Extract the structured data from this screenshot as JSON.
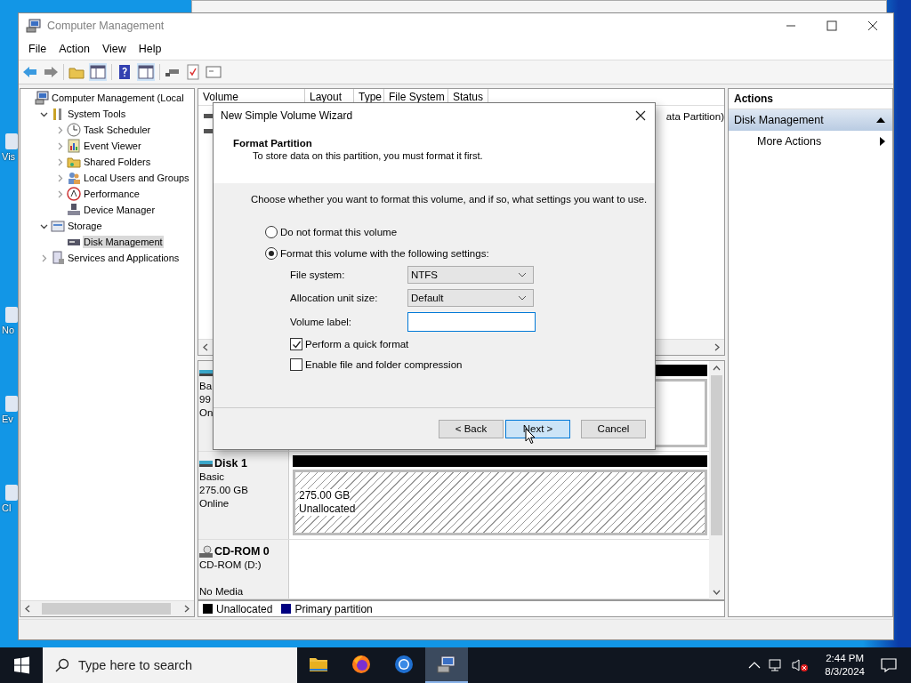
{
  "desktop_icons": [
    {
      "label": "Vis"
    },
    {
      "label": "No"
    },
    {
      "label": "Ev"
    },
    {
      "label": "Cl"
    }
  ],
  "window": {
    "title": "Computer Management"
  },
  "menu": [
    "File",
    "Action",
    "View",
    "Help"
  ],
  "tree": [
    {
      "label": "Computer Management (Local",
      "selected": false,
      "children": [
        {
          "label": "System Tools",
          "expanded": true,
          "selected": false,
          "children": [
            {
              "label": "Task Scheduler",
              "expanded": false,
              "selected": false
            },
            {
              "label": "Event Viewer",
              "expanded": false,
              "selected": false
            },
            {
              "label": "Shared Folders",
              "expanded": false,
              "selected": false
            },
            {
              "label": "Local Users and Groups",
              "expanded": false,
              "selected": false
            },
            {
              "label": "Performance",
              "expanded": false,
              "selected": false
            },
            {
              "label": "Device Manager",
              "selected": false
            }
          ]
        },
        {
          "label": "Storage",
          "expanded": true,
          "selected": false,
          "children": [
            {
              "label": "Disk Management",
              "selected": true
            }
          ]
        },
        {
          "label": "Services and Applications",
          "expanded": false,
          "selected": false
        }
      ]
    }
  ],
  "volume_list": {
    "columns": [
      "Volume",
      "Layout",
      "Type",
      "File System",
      "Status"
    ],
    "rows": [
      {
        "kind": "volume",
        "status": "ata Partition)"
      },
      {
        "kind": "volume"
      }
    ]
  },
  "disks": [
    {
      "kind": "disk",
      "lines": [
        "Ba",
        "99",
        "On"
      ]
    },
    {
      "kind": "disk",
      "name": "Disk 1",
      "lines": [
        "Basic",
        "275.00 GB",
        "Online"
      ],
      "partitions": [
        {
          "kind": "unallocated",
          "size": "275.00 GB",
          "status": "Unallocated"
        }
      ]
    },
    {
      "kind": "cdrom",
      "name": "CD-ROM 0",
      "lines": [
        "CD-ROM (D:)"
      ],
      "media": "No Media"
    }
  ],
  "legend": [
    {
      "label": "Unallocated",
      "color": "#000000"
    },
    {
      "label": "Primary partition",
      "color": "#000080"
    }
  ],
  "actions": {
    "title": "Actions",
    "items": [
      {
        "label": "Disk Management",
        "kind": "section",
        "selected": true
      },
      {
        "label": "More Actions",
        "kind": "submenu",
        "selected": false
      }
    ]
  },
  "dialog": {
    "title": "New Simple Volume Wizard",
    "heading": "Format Partition",
    "subtitle": "To store data on this partition, you must format it first.",
    "instruction": "Choose whether you want to format this volume, and if so, what settings you want to use.",
    "options": [
      {
        "label": "Do not format this volume",
        "selected": false
      },
      {
        "label": "Format this volume with the following settings:",
        "selected": true
      }
    ],
    "fields": [
      {
        "kind": "select",
        "label": "File system:",
        "value": "NTFS"
      },
      {
        "kind": "select",
        "label": "Allocation unit size:",
        "value": "Default"
      },
      {
        "kind": "text",
        "label": "Volume label:",
        "focused": true
      }
    ],
    "checks": [
      {
        "label": "Perform a quick format",
        "checked": true
      },
      {
        "label": "Enable file and folder compression",
        "checked": false
      }
    ],
    "buttons": [
      {
        "label": "< Back",
        "focused": false
      },
      {
        "label": "Next >",
        "focused": true
      },
      {
        "label": "Cancel",
        "focused": false
      }
    ]
  },
  "taskbar": {
    "search_placeholder": "Type here to search",
    "apps": [
      {
        "kind": "folder",
        "selected": false
      },
      {
        "kind": "fox",
        "selected": false
      },
      {
        "kind": "circle",
        "selected": false
      },
      {
        "kind": "management",
        "selected": true
      }
    ],
    "time": "2:44 PM",
    "date": "8/3/2024"
  }
}
